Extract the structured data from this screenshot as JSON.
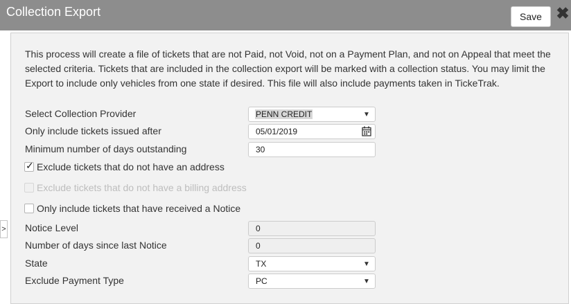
{
  "window": {
    "title": "Collection Export",
    "save_label": "Save",
    "close_icon": "✖"
  },
  "description": "This process will create a file of tickets that are not Paid, not Void, not on a Payment Plan, and not on Appeal that meet the selected criteria. Tickets that are included in the collection export will be marked with a collection status. You may limit the Export to include only vehicles from one state if desired. This file will also include payments taken in TickeTrak.",
  "side_toggle": ">",
  "form": {
    "provider": {
      "label": "Select Collection Provider",
      "value": "PENN CREDIT"
    },
    "issued_after": {
      "label": "Only include tickets issued after",
      "value": "05/01/2019"
    },
    "min_days": {
      "label": "Minimum number of days outstanding",
      "value": "30"
    },
    "exclude_no_address": {
      "label": "Exclude tickets that do not have an address",
      "checked": true,
      "mark": "✓"
    },
    "exclude_no_billing": {
      "label": "Exclude tickets that do not have a billing address",
      "checked": false,
      "disabled": true
    },
    "only_notice": {
      "label": "Only include tickets that have received a Notice",
      "checked": false
    },
    "notice_level": {
      "label": "Notice Level",
      "value": "0"
    },
    "days_since_notice": {
      "label": "Number of days since last Notice",
      "value": "0"
    },
    "state": {
      "label": "State",
      "value": "TX"
    },
    "exclude_payment_type": {
      "label": "Exclude Payment Type",
      "value": "PC"
    }
  },
  "icons": {
    "dropdown": "▼"
  }
}
